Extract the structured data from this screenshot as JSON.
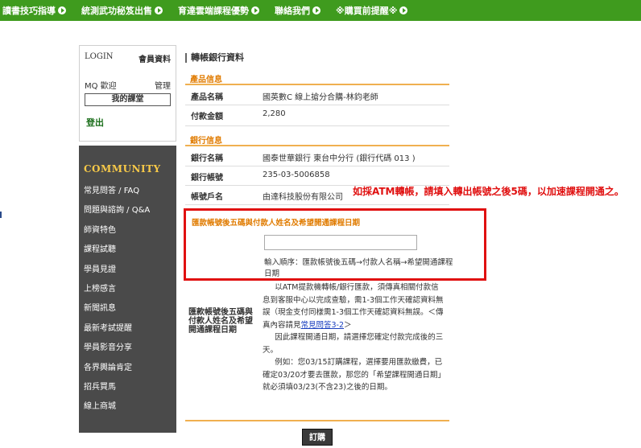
{
  "nav": [
    {
      "label": "讀書技巧指導"
    },
    {
      "label": "統測武功秘笈出售"
    },
    {
      "label": "育達雲端課程優勢"
    },
    {
      "label": "聯絡我們"
    },
    {
      "label": "※購買前提醒※"
    }
  ],
  "login": {
    "title": "LOGIN",
    "member": "會員資料",
    "welcome": "MQ 歡迎",
    "manage": "管理",
    "my_class": "我的課堂",
    "logout": "登出"
  },
  "community": {
    "title": "COMMUNITY",
    "items": [
      {
        "label": "常見問答 / FAQ"
      },
      {
        "label": "問題與諮詢 / Q&A"
      },
      {
        "label": "師資特色"
      },
      {
        "label": "課程試聽"
      },
      {
        "label": "學員見證"
      },
      {
        "label": "上榜感言"
      },
      {
        "label": "新聞訊息"
      },
      {
        "label": "最新考試提醒"
      },
      {
        "label": "學員影音分享"
      },
      {
        "label": "各界輿論肯定"
      },
      {
        "label": "招兵買馬"
      },
      {
        "label": "線上商城"
      }
    ]
  },
  "main": {
    "page_title": "轉帳銀行資料",
    "product_section": "產品信息",
    "product_name_label": "產品名稱",
    "product_name": "國英數C 線上搶分合購-林鈞老師",
    "amount_label": "付款金額",
    "amount": "2,280",
    "bank_section": "銀行信息",
    "bank_name_label": "銀行名稱",
    "bank_name": "國泰世華銀行 東台中分行 (銀行代碼 013 )",
    "account_label": "銀行帳號",
    "account": "235-03-5006858",
    "account_name_label": "帳號戶名",
    "account_name": "由達科技股份有限公司",
    "input_title": "匯款帳號後五碼與付款人姓名及希望開通課程日期",
    "input_placeholder": "",
    "input_help": "輸入順序：匯款帳號後五碼→付款人名稱→希望開通課程日期",
    "notice_label": "匯款帳號後五碼與付款人姓名及希望開通課程日期",
    "notice_p1_a": "以ATM提款機轉帳/銀行匯款，須傳真相關付款信息到客服中心以完成查驗，需1-3個工作天確認資料無誤（現金支付同樣需1-3個工作天確認資料無誤。＜傳真內容請見",
    "notice_link": "常見問答3-2",
    "notice_p1_b": "＞",
    "notice_p2": "因此課程開通日期，請選擇您確定付款完成後的三天。",
    "notice_p3": "例如：您03/15訂購課程，選擇要用匯款繳費，已確定03/20才要去匯款，那您的「希望課程開通日期」就必須填03/23(不含23)之後的日期。",
    "order_button": "訂購"
  },
  "annotation": "如採ATM轉帳，請填入轉出帳號之後5碼，以加速課程開通之。",
  "colors": {
    "nav_bg": "#3f9b1e",
    "accent_orange": "#e07b00",
    "highlight_red": "#e01010",
    "sidebar_bg": "#4a4a4a"
  }
}
